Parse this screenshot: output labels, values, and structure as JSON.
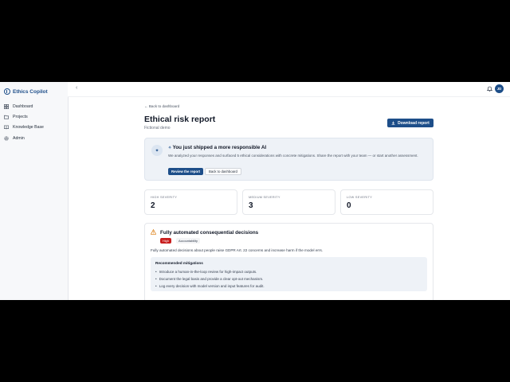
{
  "app": {
    "name": "Ethics Copilot"
  },
  "sidebar": {
    "items": [
      {
        "label": "Dashboard",
        "icon": "grid-icon"
      },
      {
        "label": "Projects",
        "icon": "folder-icon"
      },
      {
        "label": "Knowledge Base",
        "icon": "book-icon"
      },
      {
        "label": "Admin",
        "icon": "gear-icon"
      }
    ]
  },
  "topbar": {
    "avatar_initials": "JD",
    "collapse_glyph": "‹"
  },
  "page": {
    "back_link": "← Back to dashboard",
    "title": "Ethical risk report",
    "subtitle": "Fictional demo",
    "download_label": "Download report"
  },
  "banner": {
    "title": "You just shipped a more responsible AI",
    "text": "We analyzed your responses and surfaced 5 ethical considerations with concrete mitigations. Share the report with your team — or start another assessment.",
    "primary_label": "Review the report",
    "secondary_label": "Back to dashboard"
  },
  "stats": [
    {
      "label": "HIGH SEVERITY",
      "value": "2"
    },
    {
      "label": "MEDIUM SEVERITY",
      "value": "3"
    },
    {
      "label": "LOW SEVERITY",
      "value": "0"
    }
  ],
  "finding": {
    "title": "Fully automated consequential decisions",
    "severity": "High",
    "category": "Accountability",
    "description": "Fully automated decisions about people raise GDPR Art. 22 concerns and increase harm if the model errs.",
    "mitigations_title": "Recommended mitigations",
    "mitigations": [
      "Introduce a human-in-the-loop review for high-impact outputs.",
      "Document the legal basis and provide a clear opt-out mechanism.",
      "Log every decision with model version and input features for audit."
    ]
  },
  "colors": {
    "primary": "#1d4e89",
    "danger": "#c81e1e",
    "banner_bg": "#eef2f7"
  }
}
